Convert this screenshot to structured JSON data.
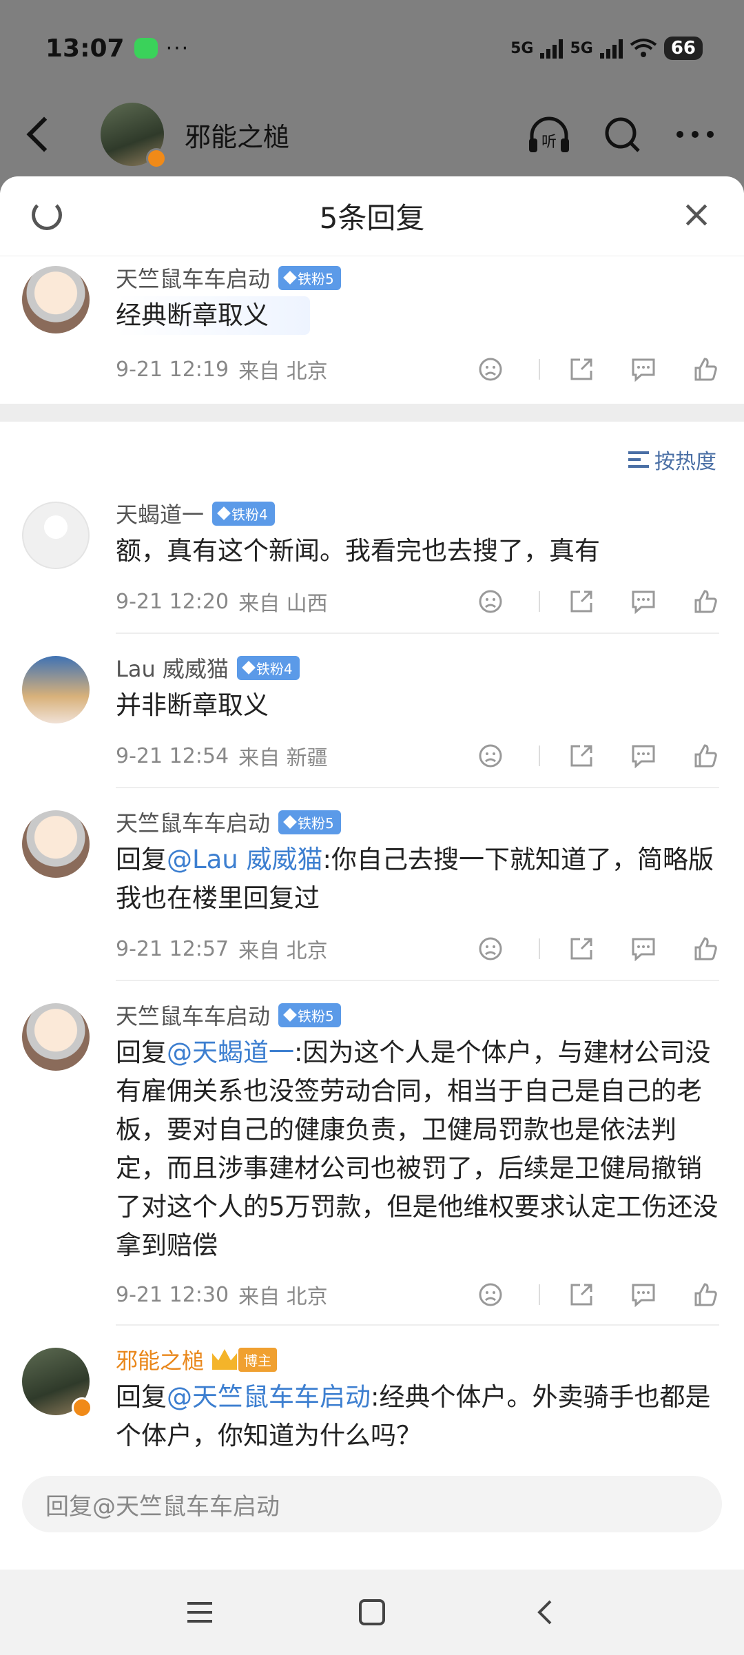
{
  "status": {
    "time": "13:07",
    "dots": "···",
    "net1": "5G",
    "net2": "5G",
    "battery": "66"
  },
  "header": {
    "name": "邪能之槌",
    "listen_label": "听"
  },
  "sheet": {
    "title": "5条回复"
  },
  "top_comment": {
    "name": "天竺鼠车车启动",
    "badge": "铁粉5",
    "text": "经典断章取义",
    "time": "9-21 12:19",
    "from": "来自 北京"
  },
  "sort_label": "按热度",
  "comments": [
    {
      "name": "天蝎道一",
      "badge": "铁粉4",
      "text": "额，真有这个新闻。我看完也去搜了，真有",
      "time": "9-21 12:20",
      "from": "来自 山西"
    },
    {
      "name": "Lau 威威猫",
      "badge": "铁粉4",
      "text": "并非断章取义",
      "time": "9-21 12:54",
      "from": "来自 新疆"
    },
    {
      "name": "天竺鼠车车启动",
      "badge": "铁粉5",
      "prefix": "回复",
      "at": "@Lau 威威猫",
      "text": ":你自己去搜一下就知道了，简略版我也在楼里回复过",
      "time": "9-21 12:57",
      "from": "来自 北京"
    },
    {
      "name": "天竺鼠车车启动",
      "badge": "铁粉5",
      "prefix": "回复",
      "at": "@天蝎道一",
      "text": ":因为这个人是个体户，与建材公司没有雇佣关系也没签劳动合同，相当于自己是自己的老板，要对自己的健康负责，卫健局罚款也是依法判定，而且涉事建材公司也被罚了，后续是卫健局撤销了对这个人的5万罚款，但是他维权要求认定工伤还没拿到赔偿",
      "time": "9-21 12:30",
      "from": "来自 北京"
    },
    {
      "name": "邪能之槌",
      "badge": "博主",
      "prefix": "回复",
      "at": "@天竺鼠车车启动",
      "text": ":经典个体户。外卖骑手也都是个体户，你知道为什么吗？"
    }
  ],
  "reply_placeholder": "回复@天竺鼠车车启动"
}
